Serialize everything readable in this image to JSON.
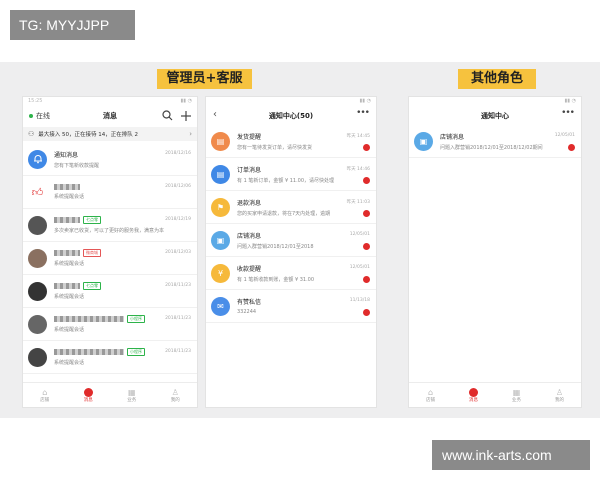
{
  "watermark_top": "TG: MYYJJPP",
  "watermark_bottom": "www.ink-arts.com",
  "sections": [
    {
      "title": "管理员+客服"
    },
    {
      "title": "其他角色"
    }
  ],
  "phone1": {
    "status_time": "15:25",
    "online_label": "在线",
    "title": "消息",
    "banner": "最大接入 50，正在接待 14，正在排队 2",
    "rows": [
      {
        "name": "通知消息",
        "sub": "您有下笔新收款提醒",
        "time": "2018/12/16",
        "avatar_color": "#3f88e6"
      },
      {
        "name": "",
        "sub": "系统提醒会话",
        "time": "2018/12/06",
        "avatar_color": "#e02b2b"
      },
      {
        "name": "",
        "badge": "七点零",
        "sub": "多次卖家已收货，可以了更好的服务我，满意为本",
        "time": "2018/12/19",
        "avatar_color": "#555"
      },
      {
        "name": "",
        "badge": "微商城",
        "sub": "系统提醒会话",
        "time": "2018/12/03",
        "avatar_color": "#8a7060"
      },
      {
        "name": "",
        "badge": "七点零",
        "sub": "系统提醒会话",
        "time": "2018/11/23",
        "avatar_color": "#333"
      },
      {
        "name": "",
        "badge": "小程序",
        "sub": "系统提醒会话",
        "time": "2018/11/23",
        "avatar_color": "#666"
      },
      {
        "name": "",
        "badge": "小程序",
        "sub": "系统提醒会话",
        "time": "2018/11/23",
        "avatar_color": "#444"
      }
    ]
  },
  "phone2": {
    "title": "通知中心(50)",
    "more": "•••",
    "rows": [
      {
        "name": "发货提醒",
        "sub": "您有一笔待发货订单，请尽快发货",
        "time": "昨天 14:45",
        "color": "#f08a4b",
        "glyph": "▤"
      },
      {
        "name": "订单消息",
        "sub": "有 1 笔新订单，金额 ¥ 11.00，请尽快处理",
        "time": "昨天 14:46",
        "color": "#3f88e6",
        "glyph": "▤"
      },
      {
        "name": "退款消息",
        "sub": "您的买家申请退款，将在7天内处理，逾期",
        "time": "昨天 11:03",
        "color": "#f6b93b",
        "glyph": "⚑"
      },
      {
        "name": "店铺消息",
        "sub": "问题入群营销2018/12/01至2018",
        "time": "12/05/01",
        "color": "#5aa9e6",
        "glyph": "▣"
      },
      {
        "name": "收款提醒",
        "sub": "有 1 笔新收款到账，金额 ¥ 31.00",
        "time": "12/05/01",
        "color": "#f6b93b",
        "glyph": "¥"
      },
      {
        "name": "有赞私信",
        "sub": "332244",
        "time": "11/13/18",
        "color": "#4a8ee8",
        "glyph": "✉"
      }
    ]
  },
  "phone3": {
    "title": "通知中心",
    "more": "•••",
    "rows": [
      {
        "name": "店铺消息",
        "sub": "问题入群营销2018/12/01至2018/12/02期间",
        "time": "12/05/01",
        "color": "#5aa9e6",
        "glyph": "▣"
      }
    ]
  },
  "tabs": [
    "店铺",
    "消息",
    "业务",
    "我的"
  ]
}
